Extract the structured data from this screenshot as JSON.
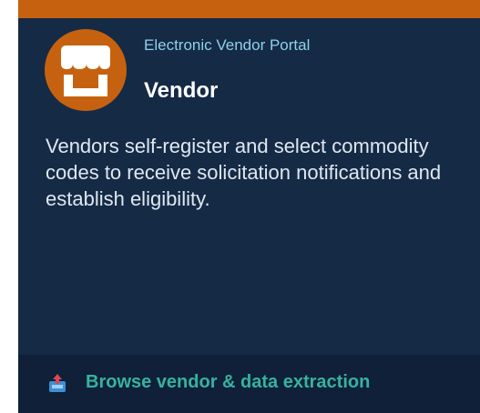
{
  "card": {
    "subtitle": "Electronic Vendor Portal",
    "title": "Vendor",
    "description": "Vendors self-register and select commodity codes to receive solicitation notifications and establish eligibility.",
    "icon": "storefront-icon"
  },
  "footer": {
    "link_label": "Browse vendor & data extraction",
    "icon": "upload-tray-icon"
  },
  "colors": {
    "accent": "#c6620f",
    "card_background": "#152a45",
    "footer_background": "#0f2038",
    "link": "#37b2a0",
    "subtitle": "#8fd0e8"
  }
}
